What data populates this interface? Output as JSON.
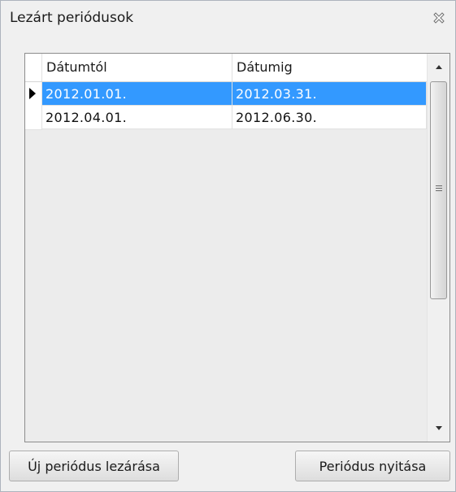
{
  "window": {
    "title": "Lezárt periódusok"
  },
  "grid": {
    "columns": [
      "Dátumtól",
      "Dátumig"
    ],
    "rows": [
      {
        "from": "2012.01.01.",
        "to": "2012.03.31.",
        "selected": true
      },
      {
        "from": "2012.04.01.",
        "to": "2012.06.30.",
        "selected": false
      }
    ]
  },
  "buttons": {
    "close_new": "Új periódus lezárása",
    "open": "Periódus nyitása"
  },
  "colors": {
    "selection": "#3399ff",
    "window_bg": "#f0f0f0"
  },
  "icons": {
    "close": "close-icon",
    "row_pointer": "row-pointer-arrow-icon",
    "scroll_up": "chevron-up-icon",
    "scroll_down": "chevron-down-icon",
    "grip": "scroll-grip-icon"
  }
}
